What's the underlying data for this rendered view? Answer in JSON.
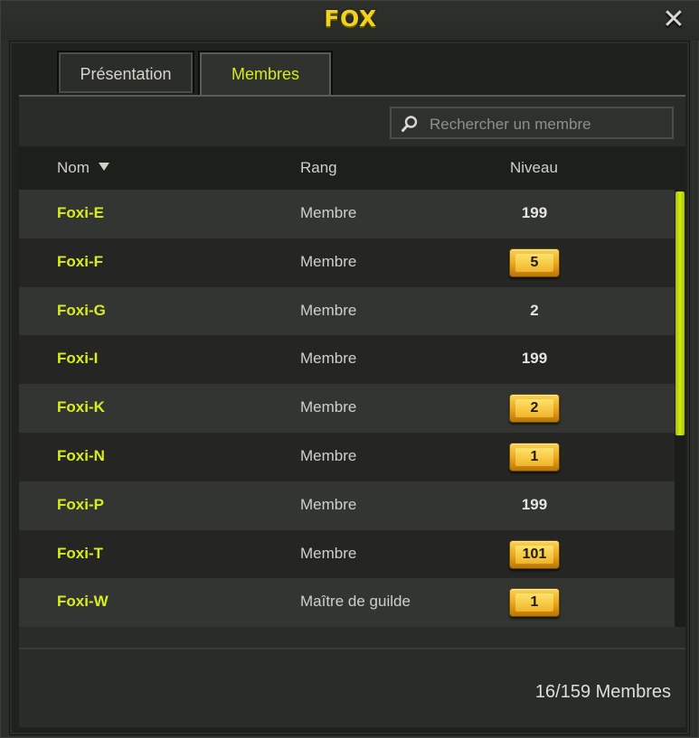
{
  "window": {
    "title": "FOX",
    "close_icon": "close-icon"
  },
  "tabs": [
    {
      "label": "Présentation",
      "active": false
    },
    {
      "label": "Membres",
      "active": true
    }
  ],
  "search": {
    "placeholder": "Rechercher un membre",
    "icon": "search-icon"
  },
  "table": {
    "columns": {
      "name": "Nom",
      "rank": "Rang",
      "level": "Niveau"
    },
    "sort": {
      "column": "Nom",
      "direction": "descending-arrow"
    },
    "rows": [
      {
        "name": "Foxi-E",
        "rank": "Membre",
        "level": "199",
        "badge": false
      },
      {
        "name": "Foxi-F",
        "rank": "Membre",
        "level": "5",
        "badge": true
      },
      {
        "name": "Foxi-G",
        "rank": "Membre",
        "level": "2",
        "badge": false
      },
      {
        "name": "Foxi-I",
        "rank": "Membre",
        "level": "199",
        "badge": false
      },
      {
        "name": "Foxi-K",
        "rank": "Membre",
        "level": "2",
        "badge": true
      },
      {
        "name": "Foxi-N",
        "rank": "Membre",
        "level": "1",
        "badge": true
      },
      {
        "name": "Foxi-P",
        "rank": "Membre",
        "level": "199",
        "badge": false
      },
      {
        "name": "Foxi-T",
        "rank": "Membre",
        "level": "101",
        "badge": true
      },
      {
        "name": "Foxi-W",
        "rank": "Maître de guilde",
        "level": "1",
        "badge": true
      }
    ]
  },
  "footer": {
    "member_count": "16/159 Membres"
  },
  "colors": {
    "title": "#f2d31b",
    "accent": "#d7ea1d",
    "badge_gold": "#f0b42a",
    "scrollbar": "#c4dc0a"
  }
}
